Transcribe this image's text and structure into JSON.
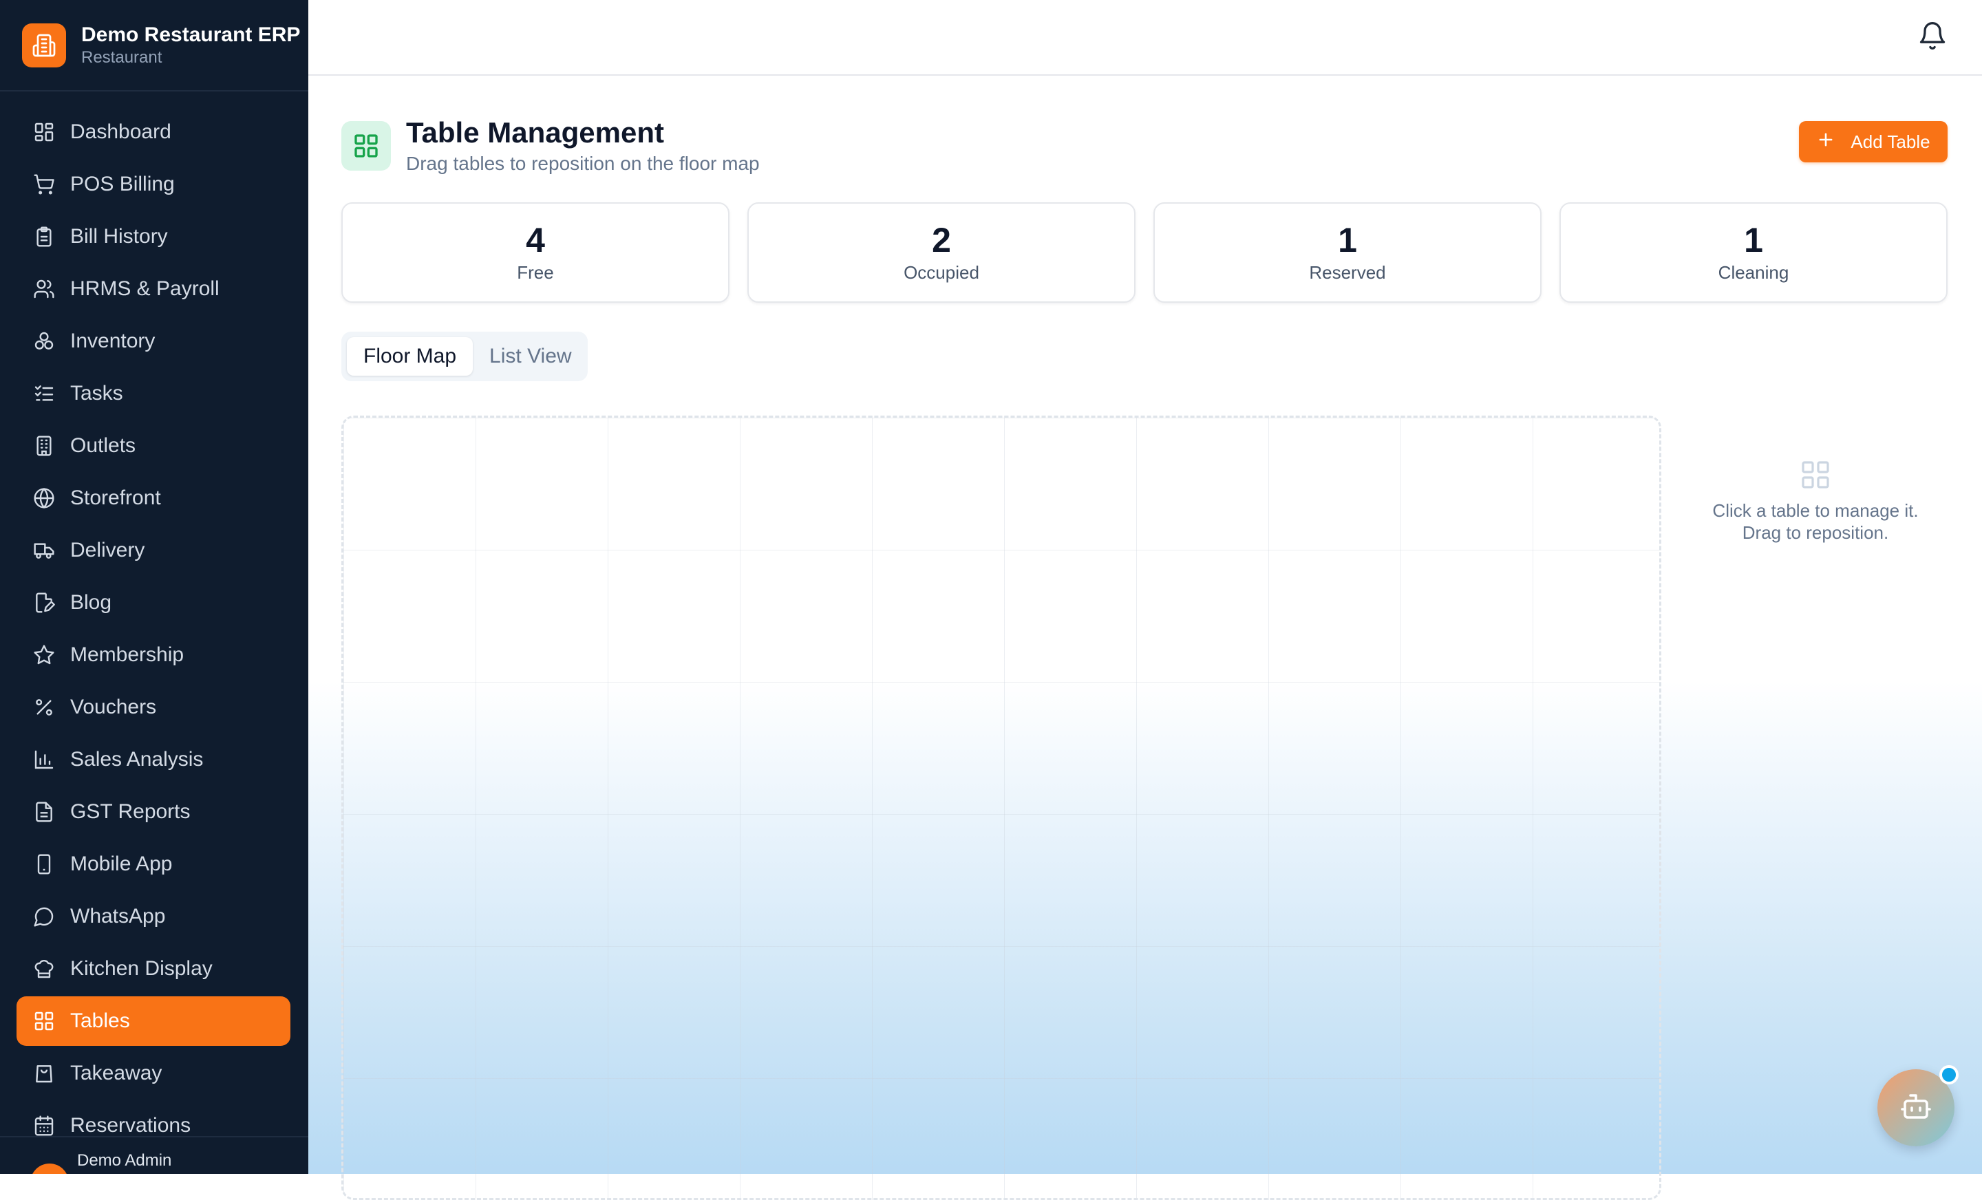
{
  "brand": {
    "title": "Demo Restaurant ERP",
    "subtitle": "Restaurant",
    "logo_icon": "building-icon"
  },
  "sidebar": {
    "items": [
      {
        "label": "Dashboard",
        "icon": "dashboard-icon"
      },
      {
        "label": "POS Billing",
        "icon": "cart-icon"
      },
      {
        "label": "Bill History",
        "icon": "clipboard-icon"
      },
      {
        "label": "HRMS & Payroll",
        "icon": "users-icon"
      },
      {
        "label": "Inventory",
        "icon": "boxes-icon"
      },
      {
        "label": "Tasks",
        "icon": "checklist-icon"
      },
      {
        "label": "Outlets",
        "icon": "building-icon"
      },
      {
        "label": "Storefront",
        "icon": "globe-icon"
      },
      {
        "label": "Delivery",
        "icon": "truck-icon"
      },
      {
        "label": "Blog",
        "icon": "file-edit-icon"
      },
      {
        "label": "Membership",
        "icon": "star-icon"
      },
      {
        "label": "Vouchers",
        "icon": "percent-icon"
      },
      {
        "label": "Sales Analysis",
        "icon": "bar-chart-icon"
      },
      {
        "label": "GST Reports",
        "icon": "document-icon"
      },
      {
        "label": "Mobile App",
        "icon": "smartphone-icon"
      },
      {
        "label": "WhatsApp",
        "icon": "message-circle-icon"
      },
      {
        "label": "Kitchen Display",
        "icon": "chef-hat-icon"
      },
      {
        "label": "Tables",
        "icon": "grid-icon",
        "active": true
      },
      {
        "label": "Takeaway",
        "icon": "shopping-bag-icon"
      },
      {
        "label": "Reservations",
        "icon": "calendar-icon"
      }
    ],
    "footer_user": "Demo Admin"
  },
  "header": {
    "notification_icon": "bell-icon"
  },
  "page": {
    "title": "Table Management",
    "subtitle": "Drag tables to reposition on the floor map",
    "add_button_label": "Add Table"
  },
  "stats": [
    {
      "value": "4",
      "label": "Free"
    },
    {
      "value": "2",
      "label": "Occupied"
    },
    {
      "value": "1",
      "label": "Reserved"
    },
    {
      "value": "1",
      "label": "Cleaning"
    }
  ],
  "views": {
    "floor_map": "Floor Map",
    "list_view": "List View",
    "selected": "Floor Map"
  },
  "hint": {
    "line1": "Click a table to manage it.",
    "line2": "Drag to reposition."
  },
  "colors": {
    "accent": "#f97316",
    "sidebar_bg": "#0f1c2e",
    "header_icon_bg": "#d9f5e7",
    "header_icon_fg": "#16a34a"
  }
}
